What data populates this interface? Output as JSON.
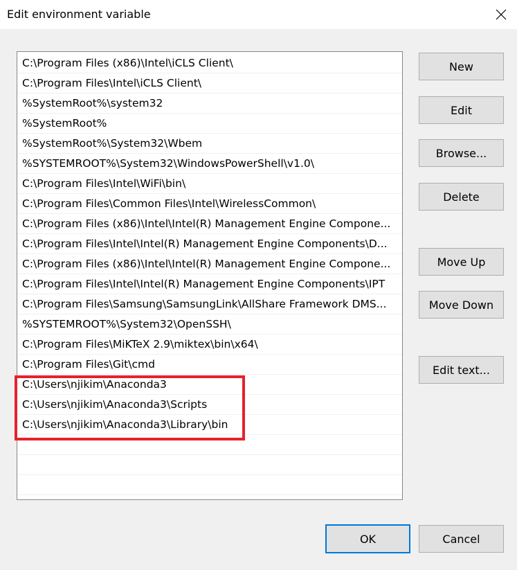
{
  "window": {
    "title": "Edit environment variable"
  },
  "list": {
    "items": [
      "C:\\Program Files (x86)\\Intel\\iCLS Client\\",
      "C:\\Program Files\\Intel\\iCLS Client\\",
      "%SystemRoot%\\system32",
      "%SystemRoot%",
      "%SystemRoot%\\System32\\Wbem",
      "%SYSTEMROOT%\\System32\\WindowsPowerShell\\v1.0\\",
      "C:\\Program Files\\Intel\\WiFi\\bin\\",
      "C:\\Program Files\\Common Files\\Intel\\WirelessCommon\\",
      "C:\\Program Files (x86)\\Intel\\Intel(R) Management Engine Compone...",
      "C:\\Program Files\\Intel\\Intel(R) Management Engine Components\\D...",
      "C:\\Program Files (x86)\\Intel\\Intel(R) Management Engine Compone...",
      "C:\\Program Files\\Intel\\Intel(R) Management Engine Components\\IPT",
      "C:\\Program Files\\Samsung\\SamsungLink\\AllShare Framework DMS...",
      "%SYSTEMROOT%\\System32\\OpenSSH\\",
      "C:\\Program Files\\MiKTeX 2.9\\miktex\\bin\\x64\\",
      "C:\\Program Files\\Git\\cmd",
      "C:\\Users\\njikim\\Anaconda3",
      "C:\\Users\\njikim\\Anaconda3\\Scripts",
      "C:\\Users\\njikim\\Anaconda3\\Library\\bin",
      "",
      "",
      ""
    ]
  },
  "buttons": {
    "new": "New",
    "edit": "Edit",
    "browse": "Browse...",
    "delete": "Delete",
    "move_up": "Move Up",
    "move_down": "Move Down",
    "edit_text": "Edit text...",
    "ok": "OK",
    "cancel": "Cancel"
  },
  "colors": {
    "highlight": "#e8202a",
    "default_button_border": "#0078d7"
  }
}
